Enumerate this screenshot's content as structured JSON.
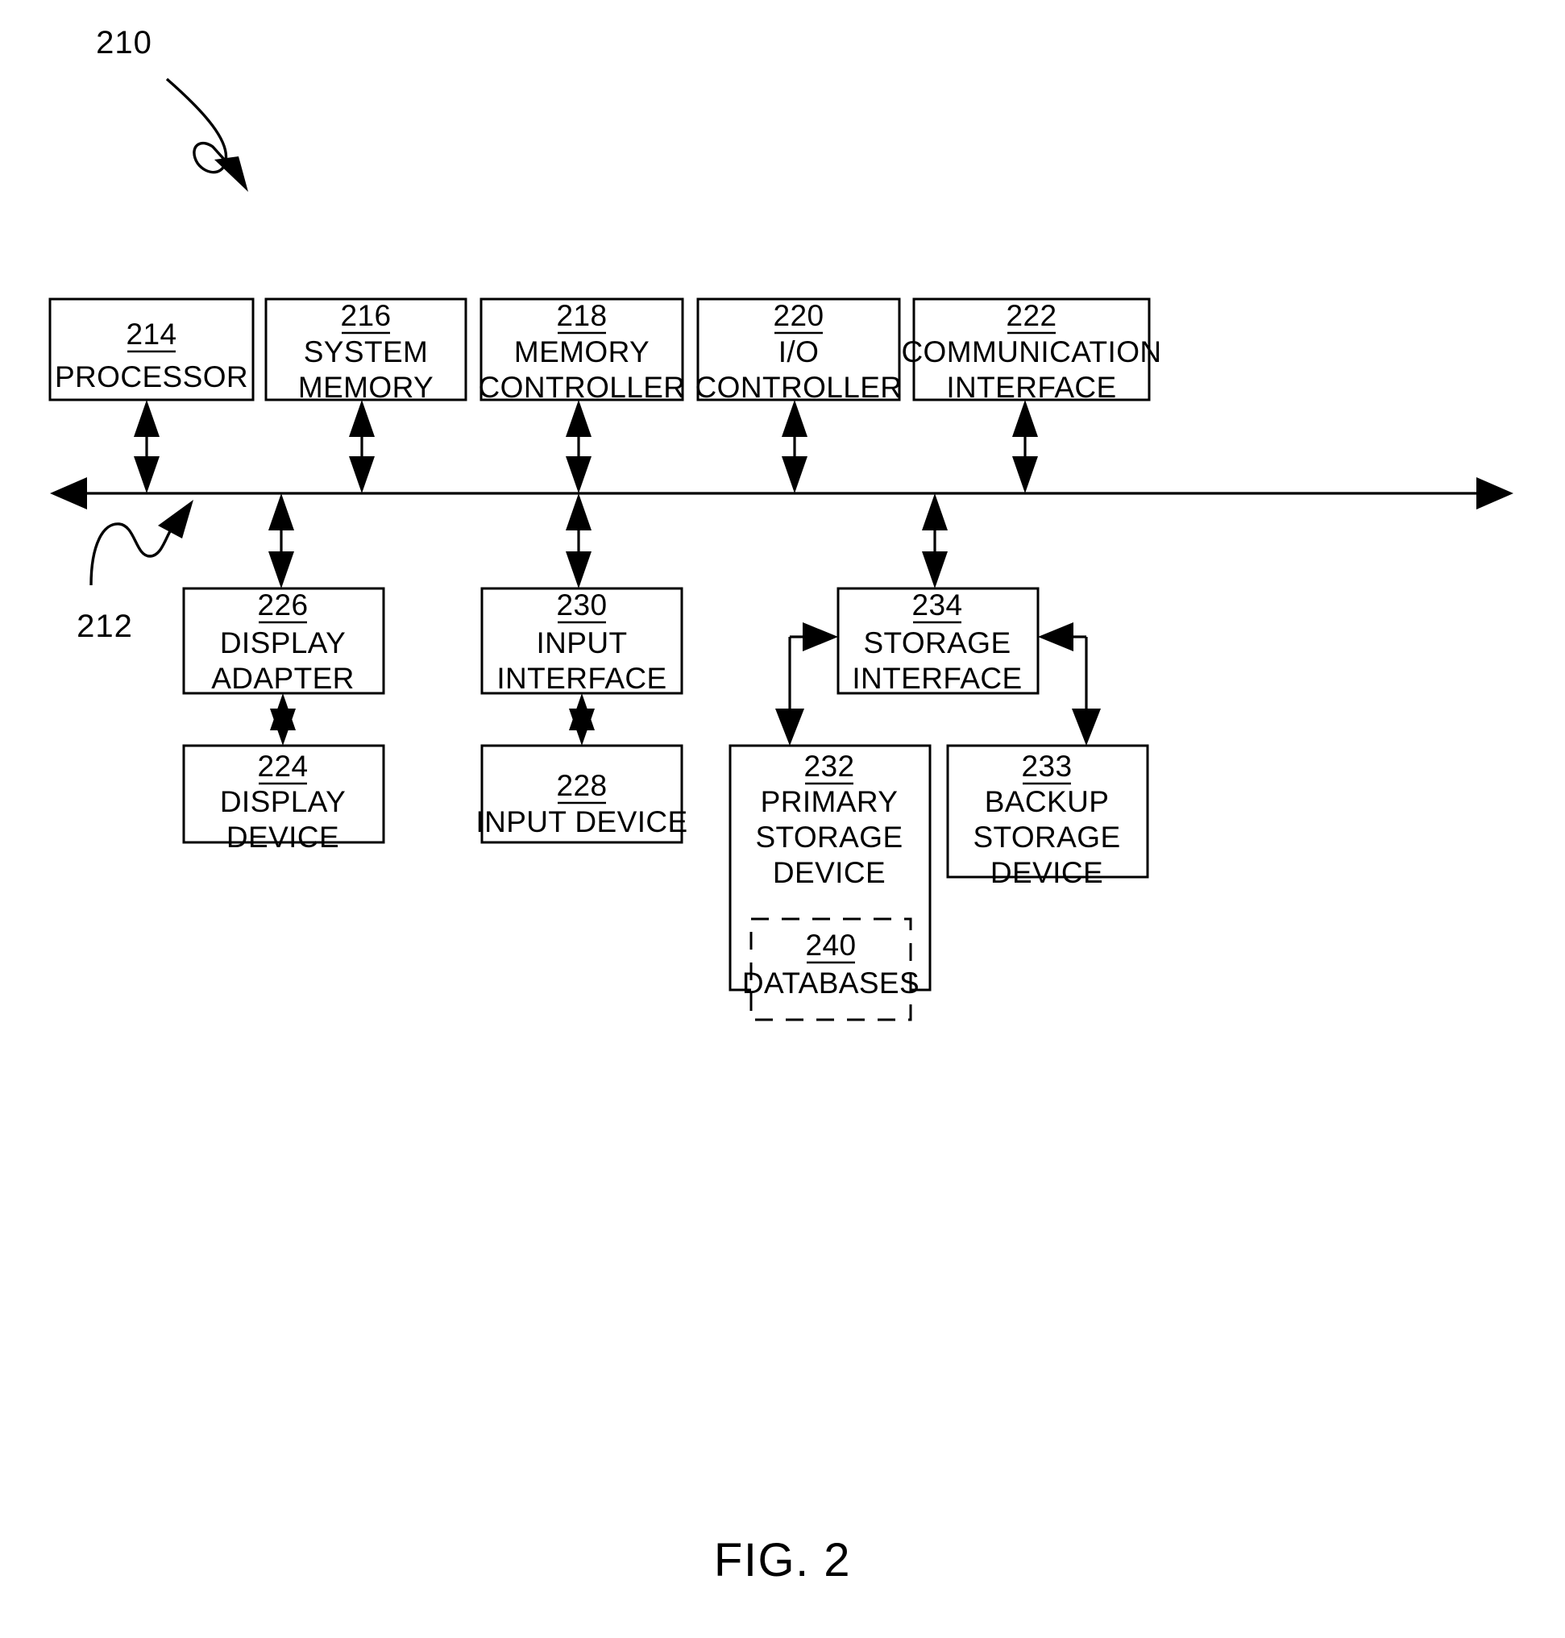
{
  "figure": {
    "caption": "FIG. 2",
    "callouts": [
      {
        "id": "callout-210",
        "number": "210"
      },
      {
        "id": "callout-212",
        "number": "212"
      }
    ]
  },
  "blocks": {
    "processor": {
      "ref": "214",
      "lines": [
        "PROCESSOR"
      ]
    },
    "system_memory": {
      "ref": "216",
      "lines": [
        "SYSTEM",
        "MEMORY"
      ]
    },
    "memory_controller": {
      "ref": "218",
      "lines": [
        "MEMORY",
        "CONTROLLER"
      ]
    },
    "io_controller": {
      "ref": "220",
      "lines": [
        "I/O",
        "CONTROLLER"
      ]
    },
    "communication_interface": {
      "ref": "222",
      "lines": [
        "COMMUNICATION",
        "INTERFACE"
      ]
    },
    "display_adapter": {
      "ref": "226",
      "lines": [
        "DISPLAY",
        "ADAPTER"
      ]
    },
    "input_interface": {
      "ref": "230",
      "lines": [
        "INPUT",
        "INTERFACE"
      ]
    },
    "storage_interface": {
      "ref": "234",
      "lines": [
        "STORAGE",
        "INTERFACE"
      ]
    },
    "display_device": {
      "ref": "224",
      "lines": [
        "DISPLAY",
        "DEVICE"
      ]
    },
    "input_device": {
      "ref": "228",
      "lines": [
        "INPUT DEVICE"
      ]
    },
    "primary_storage_device": {
      "ref": "232",
      "lines": [
        "PRIMARY",
        "STORAGE",
        "DEVICE"
      ]
    },
    "backup_storage_device": {
      "ref": "233",
      "lines": [
        "BACKUP",
        "STORAGE",
        "DEVICE"
      ]
    },
    "databases": {
      "ref": "240",
      "lines": [
        "DATABASES"
      ]
    }
  },
  "colors": {
    "stroke": "#000000",
    "fill": "#ffffff"
  }
}
